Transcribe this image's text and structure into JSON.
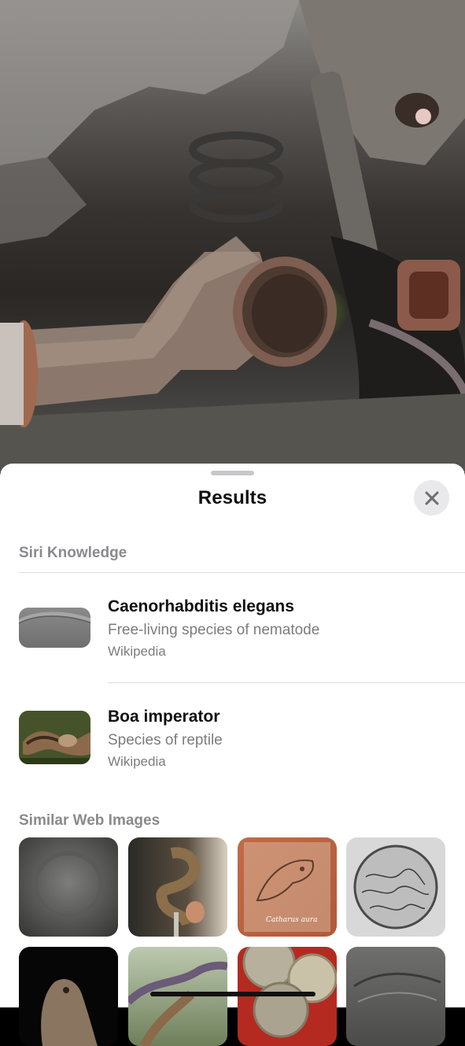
{
  "sheet": {
    "title": "Results"
  },
  "siri_knowledge": {
    "heading": "Siri Knowledge",
    "results": [
      {
        "title": "Caenorhabditis elegans",
        "subtitle": "Free-living species of nematode",
        "source": "Wikipedia",
        "thumb_icon": "nematode-thumbnail"
      },
      {
        "title": "Boa imperator",
        "subtitle": "Species of reptile",
        "source": "Wikipedia",
        "thumb_icon": "boa-thumbnail"
      }
    ]
  },
  "similar_images": {
    "heading": "Similar Web Images",
    "images": [
      {
        "icon": "stone-carving-image"
      },
      {
        "icon": "snake-on-stand-image"
      },
      {
        "icon": "bird-sketch-image",
        "caption": "Catharus aura"
      },
      {
        "icon": "texture-circle-image"
      },
      {
        "icon": "bird-figurine-image"
      },
      {
        "icon": "snake-foliage-image"
      },
      {
        "icon": "coins-image"
      },
      {
        "icon": "fossil-image"
      }
    ]
  },
  "colors": {
    "sheet_bg": "#ffffff",
    "secondary_text": "#7c7c80",
    "close_button_bg": "#e9e9eb"
  }
}
